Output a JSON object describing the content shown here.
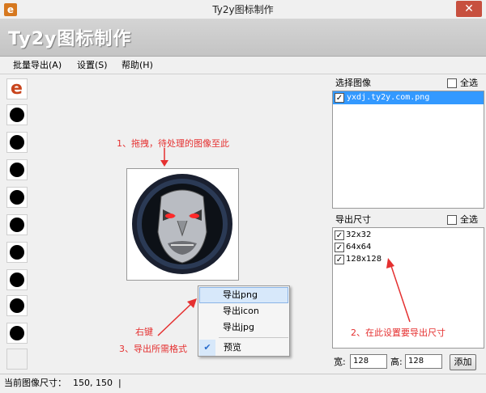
{
  "window": {
    "title": "Ty2y图标制作",
    "close_glyph": "✕"
  },
  "banner": {
    "title": "Ty2y图标制作"
  },
  "menu": [
    {
      "label": "批量导出(A)"
    },
    {
      "label": "设置(S)"
    },
    {
      "label": "帮助(H)"
    }
  ],
  "thumbnails": {
    "first_letter": "e",
    "count": 11
  },
  "select_panel": {
    "title": "选择图像",
    "select_all": "全选",
    "items": [
      {
        "name": "yxdj.ty2y.com.png",
        "checked": true,
        "selected": true
      }
    ]
  },
  "size_panel": {
    "title": "导出尺寸",
    "select_all": "全选",
    "sizes": [
      {
        "label": "32x32",
        "checked": true
      },
      {
        "label": "64x64",
        "checked": true
      },
      {
        "label": "128x128",
        "checked": true
      }
    ]
  },
  "bottom": {
    "width_label": "宽:",
    "width_value": "128",
    "height_label": "高:",
    "height_value": "128",
    "add_label": "添加"
  },
  "status": {
    "label": "当前图像尺寸：",
    "value": "150, 150",
    "sep": "|"
  },
  "context_menu": {
    "items": [
      {
        "label": "导出png"
      },
      {
        "label": "导出icon"
      },
      {
        "label": "导出jpg"
      }
    ],
    "preview": {
      "label": "预览",
      "checked": true,
      "check_glyph": "✔"
    }
  },
  "annotations": {
    "step1": "1、拖拽，待处理的图像至此",
    "step2": "2、在此设置要导出尺寸",
    "step3_line1": "右键",
    "step3_line2": "3、导出所需格式"
  },
  "colors": {
    "annotation": "#e53030",
    "selection": "#3399ff",
    "close": "#c7503f"
  }
}
